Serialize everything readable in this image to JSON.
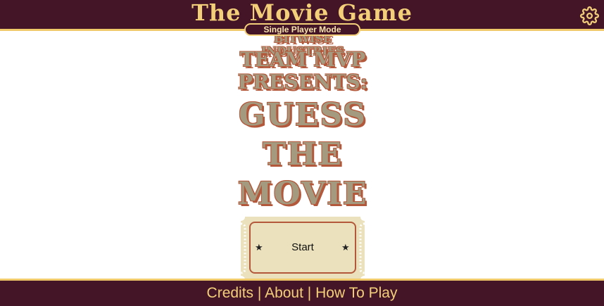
{
  "header": {
    "title": "The Movie Game",
    "mode": "Single Player Mode",
    "settings_icon": "gear-icon"
  },
  "poster": {
    "line1": "Bitwise Industries",
    "line2": "Team MVP",
    "line3": "Presents:",
    "title_words": [
      "Guess",
      "The",
      "Movie"
    ]
  },
  "start_ticket": {
    "label": "Start",
    "star": "★"
  },
  "footer": {
    "links": [
      "Credits",
      "About",
      "How To Play"
    ],
    "separator": "|"
  },
  "colors": {
    "maroon": "#431527",
    "gold": "#f3cf7a",
    "poster_fill": "#a49a80",
    "poster_outline": "#b3583a",
    "ticket_fill": "#ebe2bd"
  }
}
